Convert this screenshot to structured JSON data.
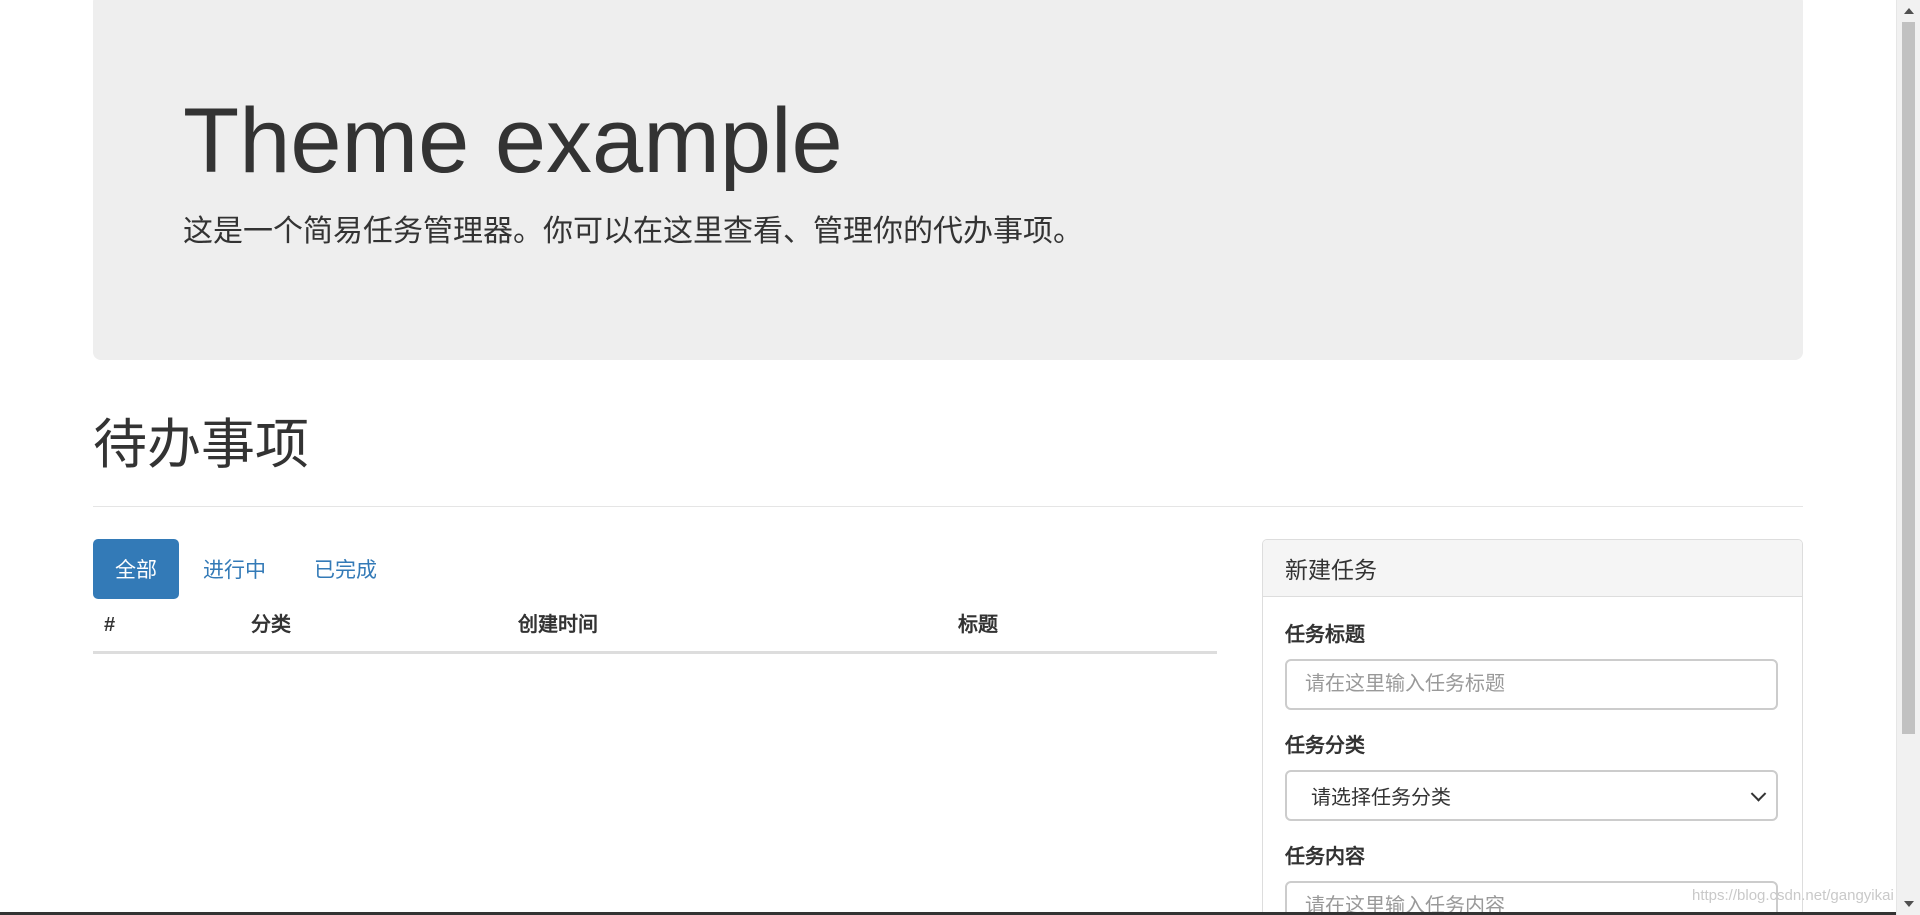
{
  "jumbotron": {
    "title": "Theme example",
    "lead": "这是一个简易任务管理器。你可以在这里查看、管理你的代办事项。"
  },
  "section": {
    "title": "待办事项"
  },
  "filters": {
    "items": [
      {
        "label": "全部",
        "active": true
      },
      {
        "label": "进行中",
        "active": false
      },
      {
        "label": "已完成",
        "active": false
      }
    ]
  },
  "table": {
    "columns": [
      "#",
      "分类",
      "创建时间",
      "标题"
    ],
    "rows": []
  },
  "new_task_panel": {
    "heading": "新建任务",
    "title_label": "任务标题",
    "title_placeholder": "请在这里输入任务标题",
    "category_label": "任务分类",
    "category_selected": "请选择任务分类",
    "content_label": "任务内容",
    "content_placeholder": "请在这里输入任务内容"
  },
  "watermark": "https://blog.csdn.net/gangyikai",
  "colors": {
    "primary": "#337ab7",
    "jumbotron_bg": "#eeeeee",
    "text": "#333333"
  }
}
